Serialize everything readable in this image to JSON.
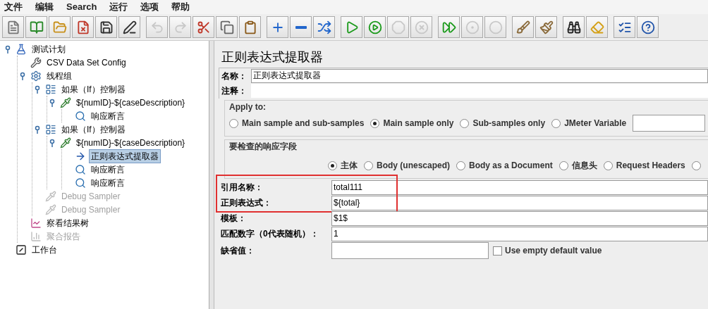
{
  "menu": [
    "文件",
    "编辑",
    "Search",
    "运行",
    "选项",
    "帮助"
  ],
  "toolbar": [
    [
      {
        "kind": "new",
        "disabled": false
      },
      {
        "kind": "templates",
        "disabled": false
      },
      {
        "kind": "open",
        "disabled": false
      },
      {
        "kind": "close",
        "disabled": false
      },
      {
        "kind": "save",
        "disabled": false
      },
      {
        "kind": "save-as",
        "disabled": false
      }
    ],
    [
      {
        "kind": "undo",
        "disabled": true
      },
      {
        "kind": "redo",
        "disabled": true
      },
      {
        "kind": "cut",
        "disabled": false
      },
      {
        "kind": "copy",
        "disabled": false
      },
      {
        "kind": "paste",
        "disabled": false
      }
    ],
    [
      {
        "kind": "expand",
        "disabled": false
      },
      {
        "kind": "collapse",
        "disabled": false
      },
      {
        "kind": "toggle",
        "disabled": false
      }
    ],
    [
      {
        "kind": "start",
        "disabled": false
      },
      {
        "kind": "start-no-pause",
        "disabled": false
      },
      {
        "kind": "stop",
        "disabled": true
      },
      {
        "kind": "shutdown",
        "disabled": true
      }
    ],
    [
      {
        "kind": "remote-start",
        "disabled": false
      },
      {
        "kind": "remote-stop",
        "disabled": true
      },
      {
        "kind": "remote-shutdown",
        "disabled": true
      }
    ],
    [
      {
        "kind": "clear",
        "disabled": false
      },
      {
        "kind": "clear-all",
        "disabled": false
      }
    ],
    [
      {
        "kind": "search",
        "disabled": false
      },
      {
        "kind": "reset-search",
        "disabled": false
      }
    ],
    [
      {
        "kind": "function-helper",
        "disabled": false
      },
      {
        "kind": "help",
        "disabled": false
      }
    ]
  ],
  "tree": [
    {
      "label": "测试计划",
      "kind": "test-plan",
      "selected": false,
      "disabled": false,
      "expanded": true,
      "children": [
        {
          "label": "CSV Data Set Config",
          "kind": "config",
          "selected": false,
          "disabled": false
        },
        {
          "label": "线程组",
          "kind": "thread-group",
          "selected": false,
          "disabled": false,
          "expanded": true,
          "children": [
            {
              "label": "如果（If）控制器",
              "kind": "controller",
              "selected": false,
              "disabled": false,
              "expanded": true,
              "children": [
                {
                  "label": "${numID}-${caseDescription}",
                  "kind": "sampler",
                  "selected": false,
                  "disabled": false,
                  "expanded": true,
                  "children": [
                    {
                      "label": "响应断言",
                      "kind": "assertion",
                      "selected": false,
                      "disabled": false
                    }
                  ]
                }
              ]
            },
            {
              "label": "如果（If）控制器",
              "kind": "controller",
              "selected": false,
              "disabled": false,
              "expanded": true,
              "children": [
                {
                  "label": "${numID}-${caseDescription}",
                  "kind": "sampler",
                  "selected": false,
                  "disabled": false,
                  "expanded": true,
                  "children": [
                    {
                      "label": "正则表达式提取器",
                      "kind": "extractor",
                      "selected": true,
                      "disabled": false
                    },
                    {
                      "label": "响应断言",
                      "kind": "assertion",
                      "selected": false,
                      "disabled": false
                    },
                    {
                      "label": "响应断言",
                      "kind": "assertion",
                      "selected": false,
                      "disabled": false
                    }
                  ]
                }
              ]
            },
            {
              "label": "Debug Sampler",
              "kind": "sampler",
              "selected": false,
              "disabled": true
            },
            {
              "label": "Debug Sampler",
              "kind": "sampler",
              "selected": false,
              "disabled": true
            }
          ]
        },
        {
          "label": "察看结果树",
          "kind": "listener",
          "selected": false,
          "disabled": false
        },
        {
          "label": "聚合报告",
          "kind": "report",
          "selected": false,
          "disabled": true
        }
      ]
    },
    {
      "label": "工作台",
      "kind": "workbench",
      "selected": false,
      "disabled": false
    }
  ],
  "panel": {
    "title": "正则表达式提取器",
    "name": {
      "label": "名称：",
      "value": "正则表达式提取器"
    },
    "comment": {
      "label": "注释："
    },
    "apply_to": {
      "legend": "Apply to:",
      "options": [
        {
          "label": "Main sample and sub-samples",
          "selected": false
        },
        {
          "label": "Main sample only",
          "selected": true
        },
        {
          "label": "Sub-samples only",
          "selected": false
        },
        {
          "label": "JMeter Variable",
          "selected": false
        }
      ]
    },
    "response_field": {
      "legend": "要检查的响应字段",
      "options": [
        {
          "label": "主体",
          "selected": true
        },
        {
          "label": "Body (unescaped)",
          "selected": false
        },
        {
          "label": "Body as a Document",
          "selected": false
        },
        {
          "label": "信息头",
          "selected": false
        },
        {
          "label": "Request Headers",
          "selected": false
        },
        {
          "selected": false
        }
      ]
    },
    "fields": [
      {
        "label": "引用名称：",
        "value": "total111",
        "highlighted": true
      },
      {
        "label": "正则表达式：",
        "value": "${total}",
        "highlighted": true
      },
      {
        "label": "模板：",
        "value": "$1$",
        "highlighted": false
      },
      {
        "label": "匹配数字（0代表随机）：",
        "value": "1",
        "highlighted": false
      }
    ],
    "default": {
      "label": "缺省值：",
      "checkbox": {
        "label": "Use empty default value",
        "checked": false
      }
    }
  }
}
